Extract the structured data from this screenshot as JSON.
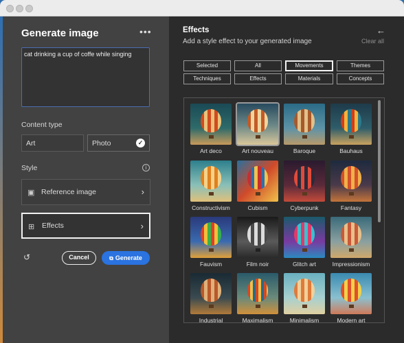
{
  "left_panel": {
    "title": "Generate image",
    "more_icon": "more-horizontal-icon",
    "prompt_text": "cat drinking a cup of coffe while singing",
    "content_type_label": "Content type",
    "content_types": [
      "Art",
      "Photo"
    ],
    "selected_content_type": "Photo",
    "style_label": "Style",
    "reference_image_label": "Reference image",
    "effects_label": "Effects",
    "cancel_label": "Cancel",
    "generate_label": "Generate"
  },
  "right_panel": {
    "title": "Effects",
    "subtitle": "Add a style effect to your generated image",
    "clear_all_label": "Clear all",
    "filters": [
      "Selected",
      "All",
      "Movements",
      "Themes",
      "Techniques",
      "Effects",
      "Materials",
      "Concepts"
    ],
    "active_filter": "Movements",
    "tiles": [
      "Art deco",
      "Art nouveau",
      "Baroque",
      "Bauhaus",
      "Constructivism",
      "Cubism",
      "Cyberpunk",
      "Fantasy",
      "Fauvism",
      "Film noir",
      "Glitch art",
      "Impressionism",
      "Industrial",
      "Maximalism",
      "Minimalism",
      "Modern art"
    ]
  }
}
